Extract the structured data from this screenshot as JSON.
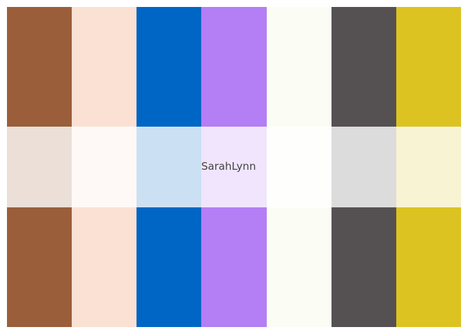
{
  "palette": {
    "name": "SarahLynn",
    "colors": [
      "#9a5f3a",
      "#fbe1d3",
      "#0066c5",
      "#b47ef5",
      "#fbfdf4",
      "#555152",
      "#dcc322"
    ],
    "middle_tint_opacity": 0.2
  }
}
